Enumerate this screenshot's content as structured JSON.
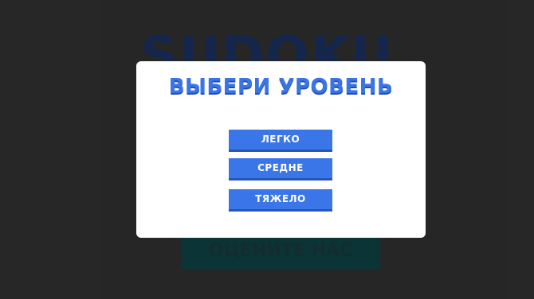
{
  "background": {
    "game_title": "SUDOKU",
    "rate_button_label": "ОЦЕНИТЕ НАС"
  },
  "modal": {
    "title": "ВЫБЕРИ УРОВЕНЬ",
    "levels": [
      {
        "label": "ЛЕГКО"
      },
      {
        "label": "СРЕДНЕ"
      },
      {
        "label": "ТЯЖЕЛО"
      }
    ]
  },
  "colors": {
    "accent": "#3a76e8",
    "title_blue": "#3b74e4",
    "background": "#313131",
    "rate_button": "#07454a"
  }
}
